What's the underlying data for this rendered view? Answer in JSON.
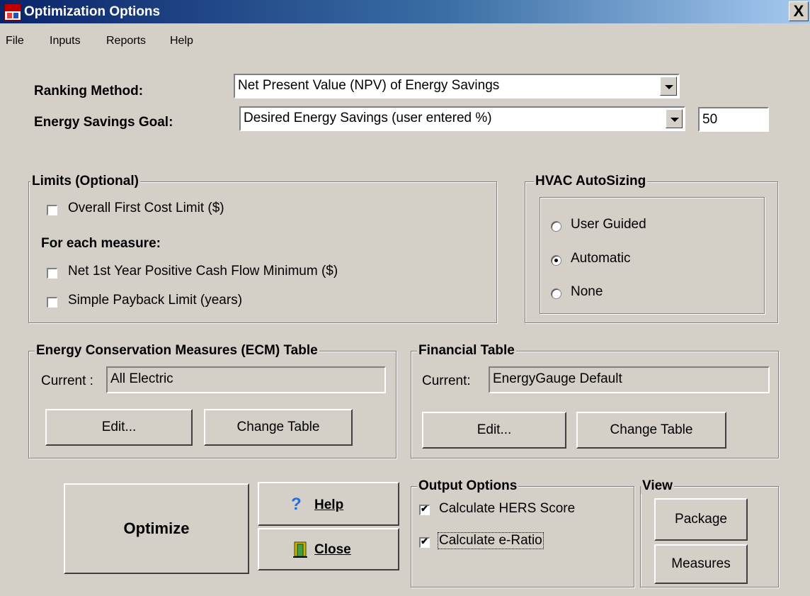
{
  "window": {
    "title": "Optimization Options",
    "close_label": "X"
  },
  "menu": [
    {
      "label": "File"
    },
    {
      "label": "Inputs"
    },
    {
      "label": "Reports"
    },
    {
      "label": "Help"
    }
  ],
  "ranking": {
    "label": "Ranking Method:",
    "value": "Net Present Value (NPV) of Energy Savings"
  },
  "goal": {
    "label": "Energy Savings Goal:",
    "value": "Desired Energy Savings (user entered %)",
    "percent": "50"
  },
  "limits": {
    "title": "Limits (Optional)",
    "overall": {
      "label": "Overall First Cost Limit ($)",
      "checked": false
    },
    "each_heading": "For each measure:",
    "cashflow": {
      "label": "Net 1st Year Positive Cash Flow Minimum ($)",
      "checked": false
    },
    "payback": {
      "label": "Simple Payback Limit (years)",
      "checked": false
    }
  },
  "hvac": {
    "title": "HVAC AutoSizing",
    "options": [
      {
        "label": "User Guided",
        "selected": false
      },
      {
        "label": "Automatic",
        "selected": true
      },
      {
        "label": "None",
        "selected": false
      }
    ]
  },
  "ecm": {
    "title": "Energy Conservation Measures (ECM) Table",
    "current_label": "Current :",
    "current_value": "All Electric",
    "edit_label": "Edit...",
    "change_label": "Change Table"
  },
  "financial": {
    "title": "Financial Table",
    "current_label": "Current:",
    "current_value": "EnergyGauge Default",
    "edit_label": "Edit...",
    "change_label": "Change Table"
  },
  "actions": {
    "optimize_label": "Optimize",
    "help_label": "Help",
    "close_label": "Close"
  },
  "output": {
    "title": "Output Options",
    "hers": {
      "label": "Calculate HERS Score",
      "checked": true
    },
    "eratio": {
      "label": "Calculate e-Ratio",
      "checked": true
    }
  },
  "view": {
    "title": "View",
    "package_label": "Package",
    "measures_label": "Measures"
  }
}
